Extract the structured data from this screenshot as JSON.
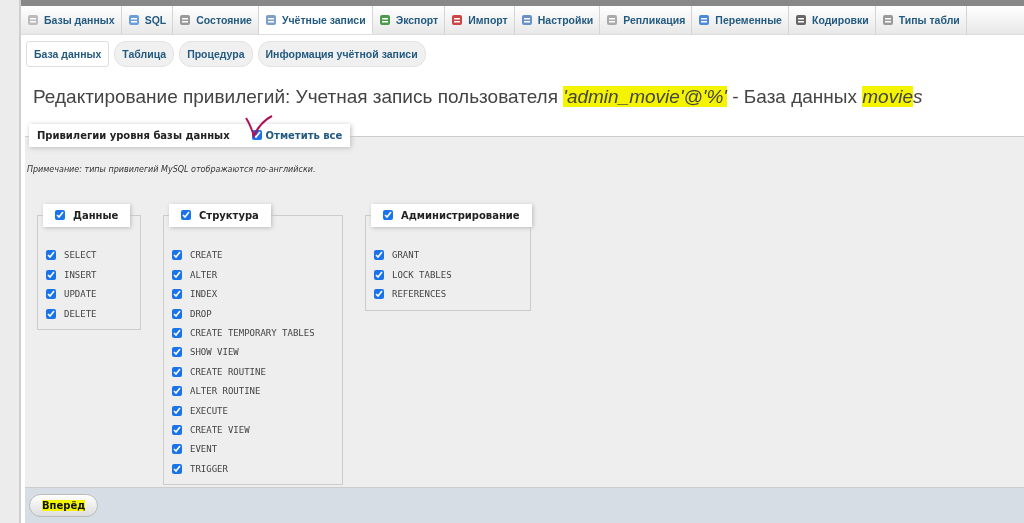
{
  "tabs": [
    {
      "label": "Базы данных",
      "selected": false
    },
    {
      "label": "SQL",
      "selected": false
    },
    {
      "label": "Состояние",
      "selected": false
    },
    {
      "label": "Учётные записи",
      "selected": true
    },
    {
      "label": "Экспорт",
      "selected": false
    },
    {
      "label": "Импорт",
      "selected": false
    },
    {
      "label": "Настройки",
      "selected": false
    },
    {
      "label": "Репликация",
      "selected": false
    },
    {
      "label": "Переменные",
      "selected": false
    },
    {
      "label": "Кодировки",
      "selected": false
    },
    {
      "label": "Типы табли",
      "selected": false
    }
  ],
  "subtabs": [
    {
      "label": "База данных",
      "selected": true
    },
    {
      "label": "Таблица",
      "selected": false
    },
    {
      "label": "Процедура",
      "selected": false
    },
    {
      "label": "Информация учётной записи",
      "selected": false
    }
  ],
  "title": [
    {
      "text": "Редактирование привилегий: Учетная запись пользователя ",
      "italic": false,
      "highlighted": false
    },
    {
      "text": "'admin_movie'@'%'",
      "italic": true,
      "highlighted": true
    },
    {
      "text": " - База данных ",
      "italic": false,
      "highlighted": false
    },
    {
      "text": "movie",
      "italic": true,
      "highlighted": true
    },
    {
      "text": "s",
      "italic": true,
      "highlighted": false
    }
  ],
  "privileges": {
    "legend": "Привилегии уровня базы данных",
    "check_all": {
      "label": "Отметить все",
      "checked": true
    },
    "note": "Примечание: типы привилегий MySQL отображаются по-английски.",
    "groups": [
      {
        "label": "Данные",
        "checked": true,
        "items": [
          {
            "label": "SELECT",
            "checked": true
          },
          {
            "label": "INSERT",
            "checked": true
          },
          {
            "label": "UPDATE",
            "checked": true
          },
          {
            "label": "DELETE",
            "checked": true
          }
        ]
      },
      {
        "label": "Структура",
        "checked": true,
        "items": [
          {
            "label": "CREATE",
            "checked": true
          },
          {
            "label": "ALTER",
            "checked": true
          },
          {
            "label": "INDEX",
            "checked": true
          },
          {
            "label": "DROP",
            "checked": true
          },
          {
            "label": "CREATE TEMPORARY TABLES",
            "checked": true
          },
          {
            "label": "SHOW VIEW",
            "checked": true
          },
          {
            "label": "CREATE ROUTINE",
            "checked": true
          },
          {
            "label": "ALTER ROUTINE",
            "checked": true
          },
          {
            "label": "EXECUTE",
            "checked": true
          },
          {
            "label": "CREATE VIEW",
            "checked": true
          },
          {
            "label": "EVENT",
            "checked": true
          },
          {
            "label": "TRIGGER",
            "checked": true
          }
        ]
      },
      {
        "label": "Администрирование",
        "checked": true,
        "items": [
          {
            "label": "GRANT",
            "checked": true
          },
          {
            "label": "LOCK TABLES",
            "checked": true
          },
          {
            "label": "REFERENCES",
            "checked": true
          }
        ]
      }
    ]
  },
  "submit": {
    "label": "Вперёд",
    "highlighted": true
  }
}
